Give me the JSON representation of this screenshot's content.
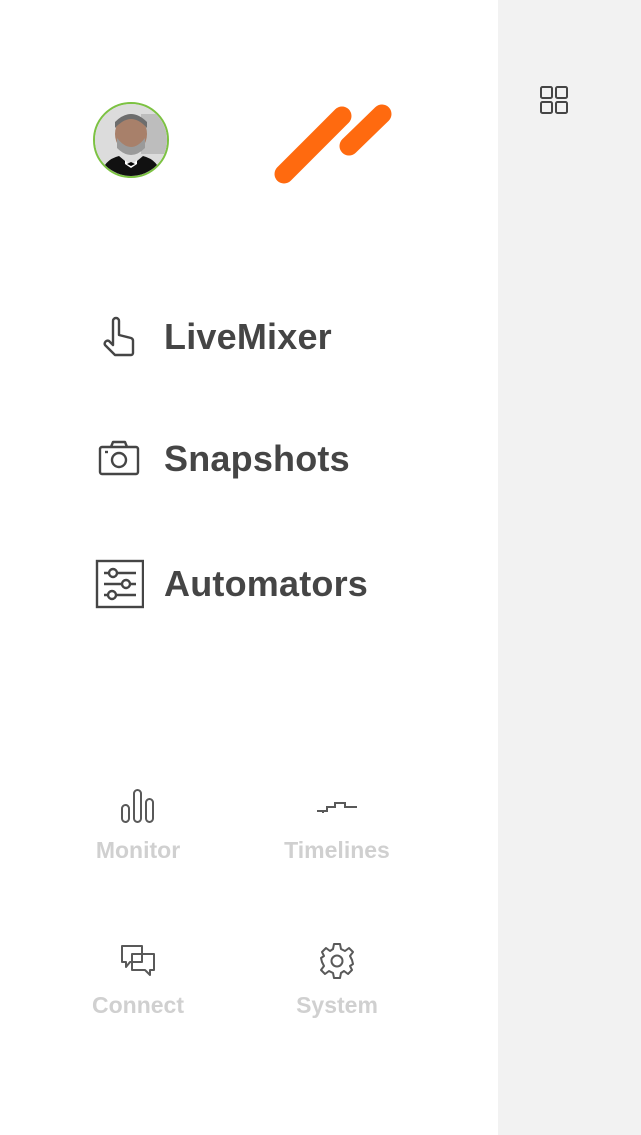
{
  "sidebar": {
    "avatar_alt": "user avatar",
    "logo_color": "#ff6a0f",
    "avatar_ring_color": "#7cc242"
  },
  "menu": {
    "items": [
      {
        "label": "LiveMixer",
        "icon": "hand-pointer-icon"
      },
      {
        "label": "Snapshots",
        "icon": "camera-icon"
      },
      {
        "label": "Automators",
        "icon": "sliders-icon"
      }
    ]
  },
  "tools": {
    "items": [
      {
        "label": "Monitor",
        "icon": "bar-chart-icon"
      },
      {
        "label": "Timelines",
        "icon": "timeline-icon"
      },
      {
        "label": "Connect",
        "icon": "chat-bubbles-icon"
      },
      {
        "label": "System",
        "icon": "gear-icon"
      }
    ]
  },
  "side_panel": {
    "icon": "grid-icon",
    "background": "#f2f2f2"
  }
}
